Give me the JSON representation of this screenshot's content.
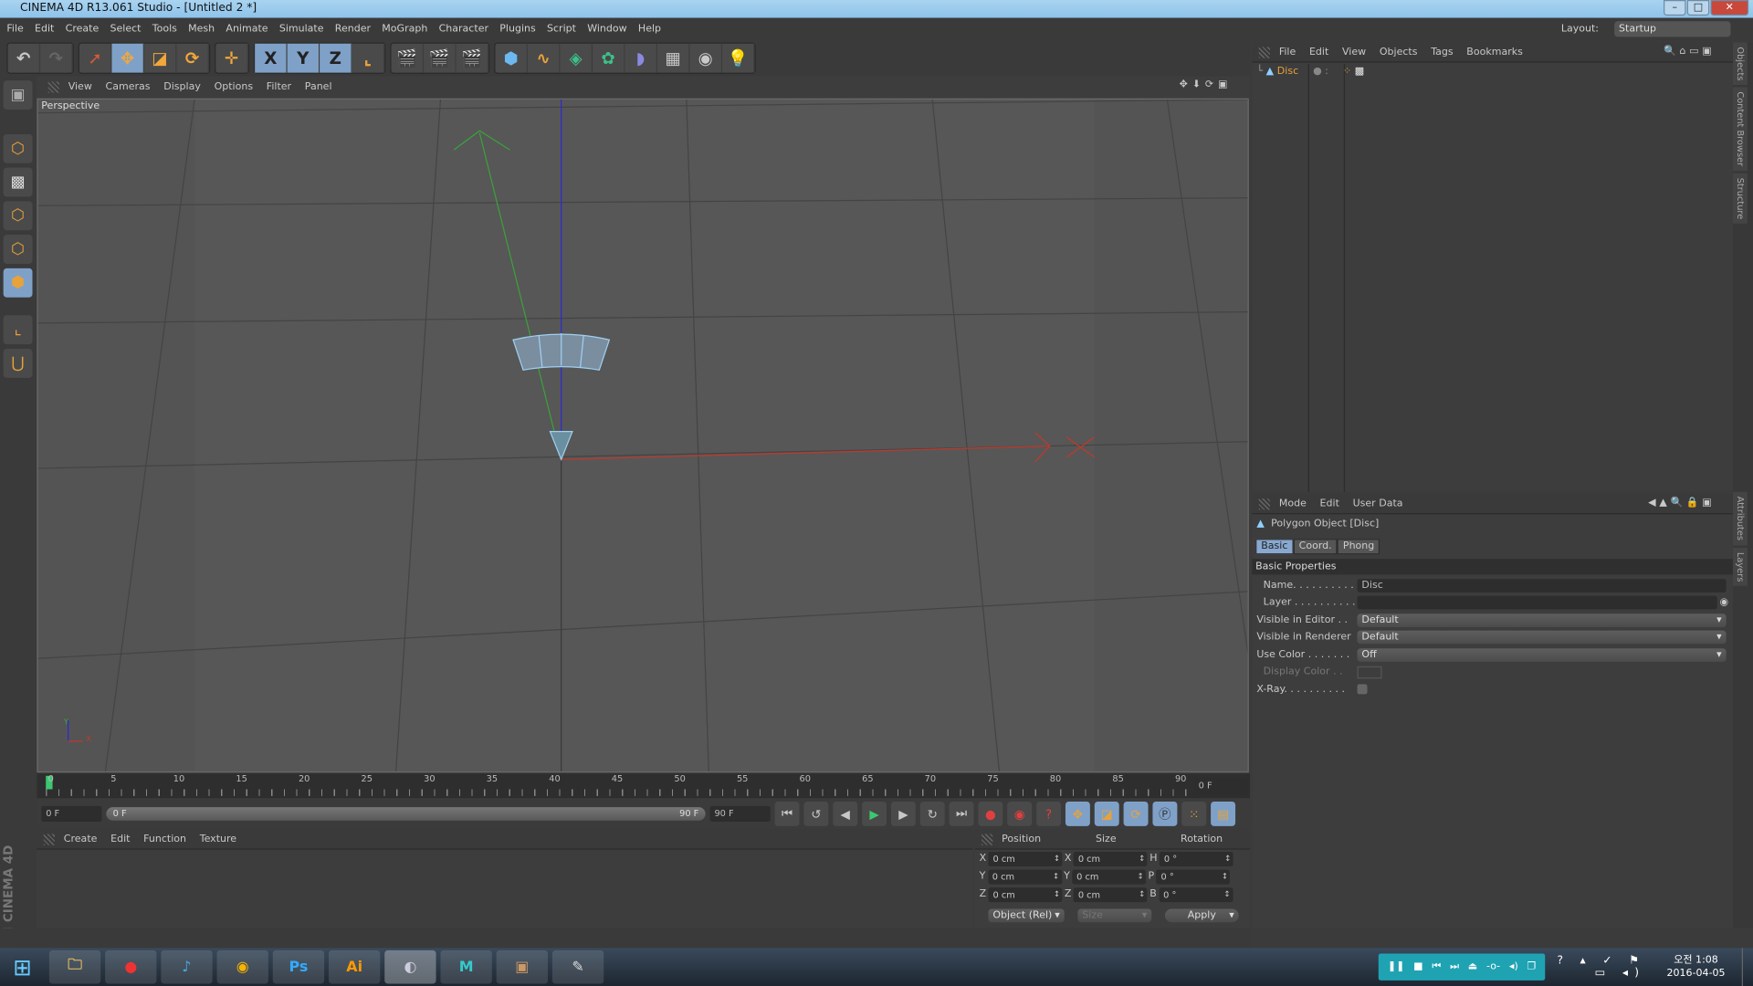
{
  "window": {
    "title": "CINEMA 4D R13.061 Studio - [Untitled 2 *]",
    "minimize": "–",
    "maximize": "□",
    "close": "✕"
  },
  "menu": [
    "File",
    "Edit",
    "Create",
    "Select",
    "Tools",
    "Mesh",
    "Animate",
    "Simulate",
    "Render",
    "MoGraph",
    "Character",
    "Plugins",
    "Script",
    "Window",
    "Help"
  ],
  "layout": {
    "label": "Layout:",
    "value": "Startup"
  },
  "toolbar": {
    "undo": "↶",
    "redo": "↷",
    "x": "X",
    "y": "Y",
    "z": "Z"
  },
  "viewport": {
    "menu": [
      "View",
      "Cameras",
      "Display",
      "Options",
      "Filter",
      "Panel"
    ],
    "label": "Perspective",
    "axis_labels": {
      "x": "X",
      "y": "Y",
      "z": "Z"
    }
  },
  "timeline": {
    "ticks": [
      "0",
      "5",
      "10",
      "15",
      "20",
      "25",
      "30",
      "35",
      "40",
      "45",
      "50",
      "55",
      "60",
      "65",
      "70",
      "75",
      "80",
      "85",
      "90"
    ],
    "current": "0 F",
    "start": "0 F",
    "slider_start": "0 F",
    "slider_end": "90 F",
    "end": "90 F"
  },
  "material_manager": {
    "menu": [
      "Create",
      "Edit",
      "Function",
      "Texture"
    ]
  },
  "coordinates": {
    "headers": [
      "Position",
      "Size",
      "Rotation"
    ],
    "rows": [
      {
        "a": "X",
        "p": "0 cm",
        "b": "X",
        "s": "0 cm",
        "c": "H",
        "r": "0 °"
      },
      {
        "a": "Y",
        "p": "0 cm",
        "b": "Y",
        "s": "0 cm",
        "c": "P",
        "r": "0 °"
      },
      {
        "a": "Z",
        "p": "0 cm",
        "b": "Z",
        "s": "0 cm",
        "c": "B",
        "r": "0 °"
      }
    ],
    "mode": "Object (Rel)",
    "size_mode": "Size",
    "apply": "Apply"
  },
  "object_manager": {
    "menu": [
      "File",
      "Edit",
      "View",
      "Objects",
      "Tags",
      "Bookmarks"
    ],
    "objects": [
      {
        "name": "Disc"
      }
    ]
  },
  "attributes": {
    "menu": [
      "Mode",
      "Edit",
      "User Data"
    ],
    "object_title": "Polygon Object [Disc]",
    "tabs": [
      "Basic",
      "Coord.",
      "Phong"
    ],
    "active_tab": "Basic",
    "section": "Basic Properties",
    "props": {
      "name_label": "Name. . . . . . . . . . .",
      "name": "Disc",
      "layer_label": "Layer . . . . . . . . . . .",
      "layer": "",
      "vis_editor_label": "Visible in Editor . .",
      "vis_editor": "Default",
      "vis_render_label": "Visible in Renderer",
      "vis_render": "Default",
      "use_color_label": "Use Color . . . . . . .",
      "use_color": "Off",
      "display_color_label": "Display Color . .",
      "xray_label": "X-Ray. . . . . . . . . .",
      "xray": false
    }
  },
  "side_tabs": [
    "Objects",
    "Content Browser",
    "Structure",
    "Attributes",
    "Layers"
  ],
  "brand": "MAXON CINEMA 4D",
  "taskbar": {
    "apps": [
      "Explorer",
      "App",
      "iTunes",
      "Chrome",
      "Ps",
      "Ai",
      "Cinema 4D",
      "Maya",
      "App",
      "Paint"
    ],
    "clock_time": "오전 1:08",
    "clock_date": "2016-04-05"
  },
  "colors": {
    "accent": "#7fa1c8",
    "viewport_bg": "#545454",
    "axis_x": "#c0392b",
    "axis_y": "#3aa33a",
    "axis_z": "#2b2bd0",
    "object_name": "#e8a23a"
  }
}
